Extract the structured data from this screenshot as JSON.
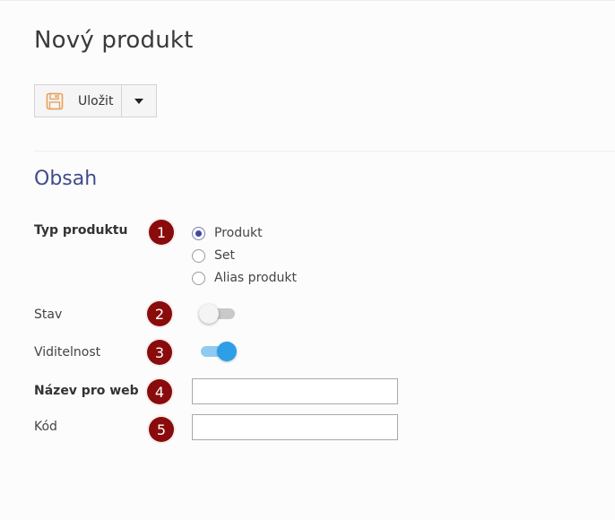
{
  "page": {
    "title": "Nový produkt"
  },
  "toolbar": {
    "save_label": "Uložit",
    "save_icon": "floppy-disk-icon",
    "dropdown_icon": "caret-down-icon"
  },
  "section": {
    "title": "Obsah"
  },
  "fields": {
    "product_type": {
      "label": "Typ produktu",
      "marker": "1",
      "options": [
        {
          "label": "Produkt",
          "selected": true
        },
        {
          "label": "Set",
          "selected": false
        },
        {
          "label": "Alias produkt",
          "selected": false
        }
      ]
    },
    "status": {
      "label": "Stav",
      "marker": "2",
      "enabled": false
    },
    "visibility": {
      "label": "Viditelnost",
      "marker": "3",
      "enabled": true
    },
    "web_name": {
      "label": "Název pro web",
      "marker": "4",
      "value": ""
    },
    "code": {
      "label": "Kód",
      "marker": "5",
      "value": ""
    }
  },
  "colors": {
    "section_title": "#3f4c8a",
    "marker": "#8a0b0b",
    "toggle_on": "#2d9fe6",
    "save_icon": "#e8a25a"
  }
}
